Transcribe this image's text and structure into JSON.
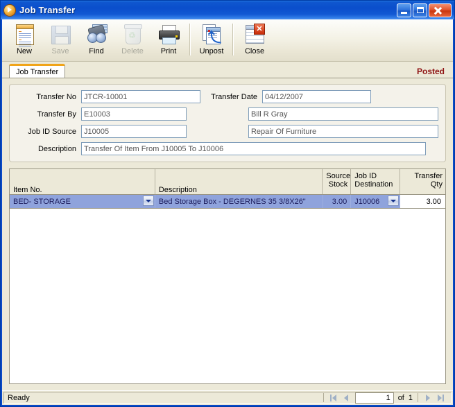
{
  "window": {
    "title": "Job Transfer",
    "icon": "app-orb-icon",
    "buttons": {
      "minimize": "minimize-button",
      "maximize": "maximize-button",
      "close": "close-button",
      "close_glyph": "✕"
    }
  },
  "toolbar": {
    "items": [
      {
        "label": "New",
        "icon": "new-document-icon",
        "enabled": true
      },
      {
        "label": "Save",
        "icon": "floppy-disk-icon",
        "enabled": false
      },
      {
        "label": "Find",
        "icon": "binoculars-icon",
        "enabled": true
      },
      {
        "label": "Delete",
        "icon": "recycle-bin-icon",
        "enabled": false
      },
      {
        "label": "Print",
        "icon": "printer-icon",
        "enabled": true
      },
      {
        "label": "Unpost",
        "icon": "unpost-icon",
        "enabled": true
      },
      {
        "label": "Close",
        "icon": "close-document-icon",
        "enabled": true
      }
    ],
    "recycle_glyph": "♲",
    "unpost_arrow_glyph": "⤴",
    "close_badge_glyph": "✕"
  },
  "tabs": {
    "items": [
      {
        "label": "Job Transfer",
        "active": true
      }
    ],
    "status_label": "Posted",
    "status_color": "#8f1414"
  },
  "form": {
    "fields": [
      {
        "label": "Transfer No",
        "value": "JTCR-10001"
      },
      {
        "label": "Transfer Date",
        "value": "04/12/2007"
      },
      {
        "label": "Transfer By",
        "value": "E10003"
      },
      {
        "label": "Transfer By Name",
        "value": "Bill R Gray"
      },
      {
        "label": "Job ID Source",
        "value": "J10005"
      },
      {
        "label": "Job Source Name",
        "value": "Repair Of Furniture"
      },
      {
        "label": "Description",
        "value": "Transfer Of Item From J10005 To J10006"
      }
    ]
  },
  "grid": {
    "columns": [
      {
        "label": "Item No.",
        "align": "left"
      },
      {
        "label": "Description",
        "align": "left"
      },
      {
        "label": "Source",
        "label2": "Stock",
        "align": "right"
      },
      {
        "label": "Job ID",
        "label2": "Destination",
        "align": "left"
      },
      {
        "label": "Transfer",
        "label2": "Qty",
        "align": "right"
      }
    ],
    "rows": [
      {
        "item_no": "BED- STORAGE",
        "description": "Bed Storage Box - DEGERNES 35 3/8X26\"",
        "source_stock": "3.00",
        "job_id_destination": "J10006",
        "transfer_qty": "3.00",
        "selected": true
      }
    ]
  },
  "statusbar": {
    "message": "Ready",
    "record_current": "1",
    "of_label": "of",
    "record_total": "1",
    "nav": {
      "first": "first-record-button",
      "previous": "previous-record-button",
      "next": "next-record-button",
      "last": "last-record-button"
    }
  }
}
